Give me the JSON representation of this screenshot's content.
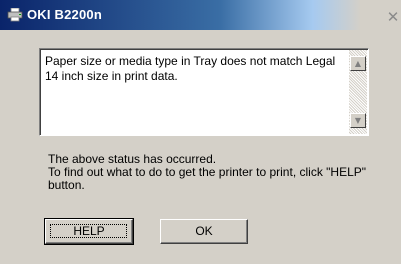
{
  "window": {
    "title": "OKI B2200n",
    "icon": "printer-icon",
    "close_glyph": "✕"
  },
  "message": {
    "text": "Paper size or media type in Tray does not match Legal 14 inch size in print data."
  },
  "scrollbar": {
    "up_glyph": "▲",
    "down_glyph": "▼"
  },
  "status": {
    "line1": "The above status has occurred.",
    "line2": "To find out what to do to get the printer to print, click \"HELP\" button."
  },
  "buttons": {
    "help_label": "HELP",
    "ok_label": "OK"
  }
}
